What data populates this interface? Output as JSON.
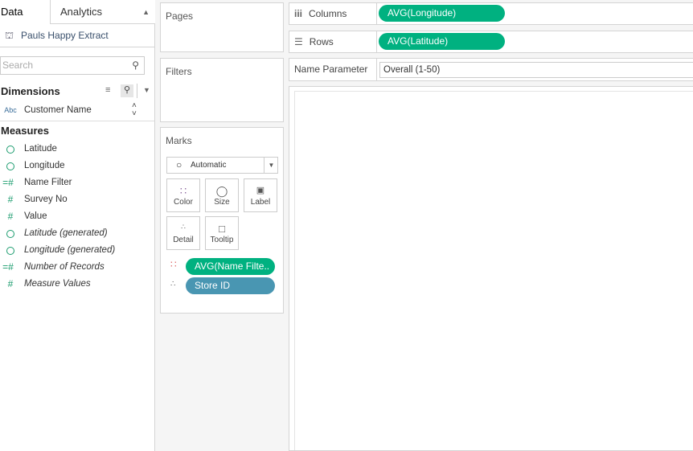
{
  "left_pane": {
    "tabs": {
      "data": "Data",
      "analytics": "Analytics"
    },
    "data_source": "Pauls Happy Extract",
    "search_placeholder": "Search",
    "dimensions_title": "Dimensions",
    "dimensions": [
      {
        "type": "Abc",
        "label": "Customer Name"
      }
    ],
    "measures_title": "Measures",
    "measures": [
      {
        "icon": "globe-icon",
        "label": "Latitude",
        "italic": false
      },
      {
        "icon": "globe-icon",
        "label": "Longitude",
        "italic": false
      },
      {
        "icon": "calc-number-icon",
        "label": "Name Filter",
        "italic": false
      },
      {
        "icon": "number-icon",
        "label": "Survey No",
        "italic": false
      },
      {
        "icon": "number-icon",
        "label": "Value",
        "italic": false
      },
      {
        "icon": "globe-icon",
        "label": "Latitude (generated)",
        "italic": true
      },
      {
        "icon": "globe-icon",
        "label": "Longitude (generated)",
        "italic": true
      },
      {
        "icon": "calc-number-icon",
        "label": "Number of Records",
        "italic": true
      },
      {
        "icon": "number-icon",
        "label": "Measure Values",
        "italic": true
      }
    ]
  },
  "cards": {
    "pages": "Pages",
    "filters": "Filters",
    "marks": "Marks",
    "mark_type": "Automatic",
    "mark_buttons": {
      "color": "Color",
      "size": "Size",
      "label": "Label",
      "detail": "Detail",
      "tooltip": "Tooltip"
    },
    "mark_pills": [
      {
        "label": "AVG(Name Filte..",
        "color": "#00b180"
      },
      {
        "label": "Store ID",
        "color": "#4996b2"
      }
    ]
  },
  "shelves": {
    "columns_label": "Columns",
    "columns_pill": "AVG(Longitude)",
    "rows_label": "Rows",
    "rows_pill": "AVG(Latitude)"
  },
  "parameter": {
    "label": "Name Parameter",
    "value": "Overall (1-50)"
  },
  "colors": {
    "green_pill": "#00b180",
    "blue_pill": "#4996b2"
  }
}
